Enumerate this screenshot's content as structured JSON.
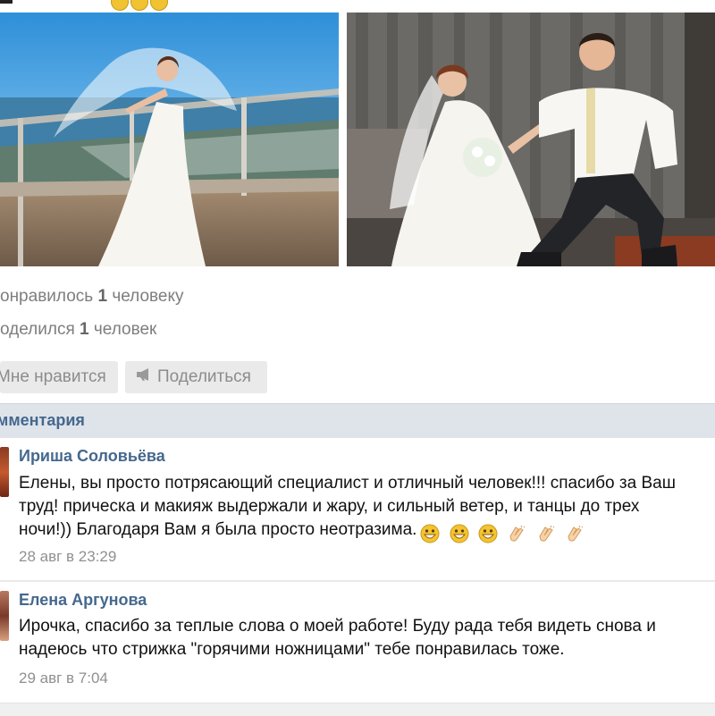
{
  "header": {
    "emoji_icons": [
      "grinning-face-icon",
      "grinning-face-icon",
      "grinning-face-icon"
    ]
  },
  "photos": [
    {
      "icon": "wedding-photo-bride-balcony"
    },
    {
      "icon": "wedding-photo-groom-kneeling"
    }
  ],
  "stats": {
    "likes_prefix": "онравилось",
    "likes_count": "1",
    "likes_suffix": "человеку",
    "shares_prefix": "оделился",
    "shares_count": "1",
    "shares_suffix": "человек"
  },
  "actions": {
    "like_label": "Мне нравится",
    "share_label": "Поделиться",
    "share_icon": "megaphone-icon"
  },
  "comments_header": "мментария",
  "comments": [
    {
      "author": "Ириша Соловьёва",
      "lines": [
        "Елены, вы просто потрясающий специалист и отличный человек!!! спасибо за Ваш",
        "труд! прическа и макияж выдержали и жару, и сильный ветер, и танцы до трех",
        "ночи!)) Благодаря Вам я была просто неотразима."
      ],
      "emoji": [
        "grinning-face-icon",
        "grinning-face-icon",
        "grinning-face-icon",
        "clapping-hands-icon",
        "clapping-hands-icon",
        "clapping-hands-icon"
      ],
      "date": "28 авг в 23:29"
    },
    {
      "author": "Елена Аргунова",
      "lines": [
        "Ирочка, спасибо за теплые слова о моей работе! Буду рада тебя видеть снова и",
        "надеюсь что стрижка \"горячими ножницами\" тебе понравилась тоже."
      ],
      "date": "29 авг в 7:04"
    }
  ],
  "colors": {
    "link": "#45688e",
    "muted": "#7e7e7e",
    "header_bg": "#dfe4ea",
    "button_bg": "#eaeaea"
  }
}
